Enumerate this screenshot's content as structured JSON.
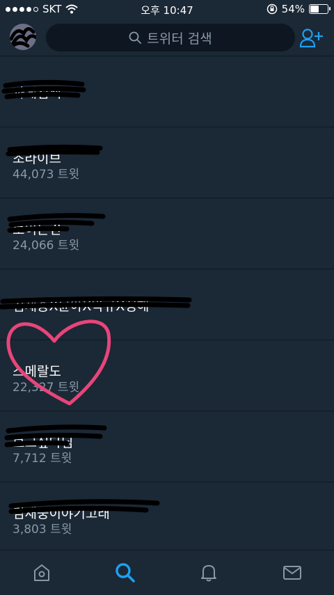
{
  "status_bar": {
    "carrier": "SKT",
    "time": "오후 10:47",
    "battery_percent": "54%",
    "battery_level": 0.54
  },
  "header": {
    "search_placeholder": "트위터 검색",
    "icons": {
      "search": "search-icon",
      "add_user": "add-user-icon"
    }
  },
  "trends": [
    {
      "title": "과게검색",
      "count": ""
    },
    {
      "title": "조라이브",
      "count": "44,073 트윗"
    },
    {
      "title": "보이는건",
      "count": "24,066 트윗"
    },
    {
      "title": "김재중X윤아X박규X정해",
      "count": ""
    },
    {
      "title": "스메랄도",
      "count": "22,327 트윗"
    },
    {
      "title": "보고싶다님",
      "count": "7,712 트윗"
    },
    {
      "title": "김재중이야기고래",
      "count": "3,803 트윗"
    }
  ],
  "tabs": {
    "home": "home-icon",
    "search": "search-icon",
    "notifications": "bell-icon",
    "messages": "mail-icon"
  },
  "colors": {
    "background": "#1b2836",
    "accent": "#1da1f2",
    "secondary_text": "#8899a6",
    "divider": "#0f1822",
    "heart": "#e8457a"
  }
}
